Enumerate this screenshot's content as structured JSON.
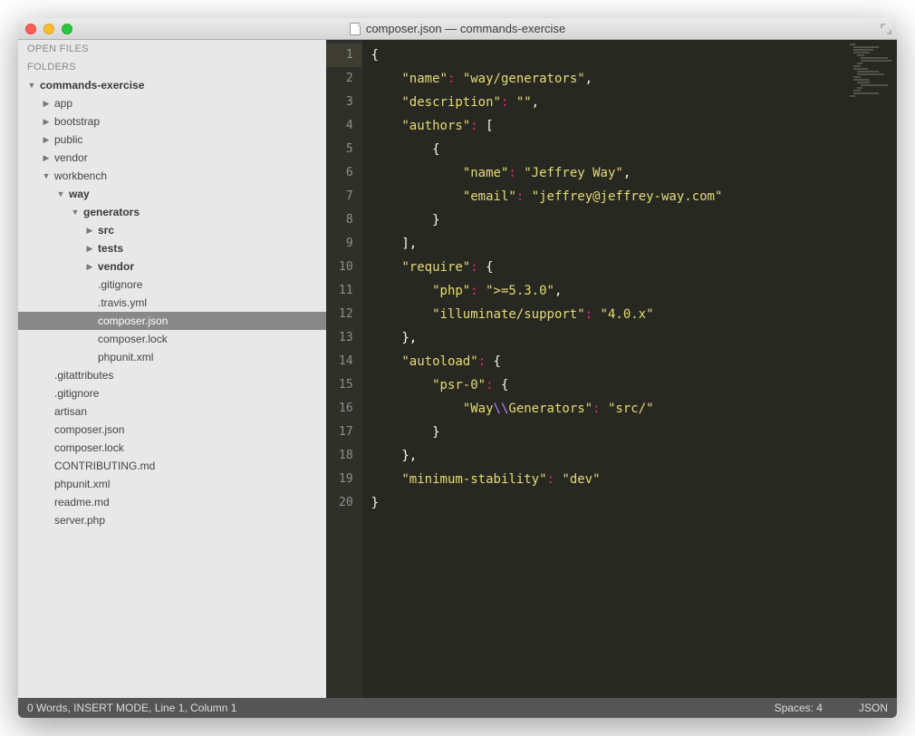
{
  "window": {
    "title": "composer.json — commands-exercise"
  },
  "sidebar": {
    "open_files_label": "OPEN FILES",
    "folders_label": "FOLDERS",
    "tree": [
      {
        "label": "commands-exercise",
        "depth": 0,
        "kind": "folder",
        "open": true,
        "bold": true
      },
      {
        "label": "app",
        "depth": 1,
        "kind": "folder",
        "open": false
      },
      {
        "label": "bootstrap",
        "depth": 1,
        "kind": "folder",
        "open": false
      },
      {
        "label": "public",
        "depth": 1,
        "kind": "folder",
        "open": false
      },
      {
        "label": "vendor",
        "depth": 1,
        "kind": "folder",
        "open": false
      },
      {
        "label": "workbench",
        "depth": 1,
        "kind": "folder",
        "open": true
      },
      {
        "label": "way",
        "depth": 2,
        "kind": "folder",
        "open": true,
        "bold": true
      },
      {
        "label": "generators",
        "depth": 3,
        "kind": "folder",
        "open": true,
        "bold": true
      },
      {
        "label": "src",
        "depth": 4,
        "kind": "folder",
        "open": false,
        "bold": true
      },
      {
        "label": "tests",
        "depth": 4,
        "kind": "folder",
        "open": false,
        "bold": true
      },
      {
        "label": "vendor",
        "depth": 4,
        "kind": "folder",
        "open": false,
        "bold": true
      },
      {
        "label": ".gitignore",
        "depth": 4,
        "kind": "file"
      },
      {
        "label": ".travis.yml",
        "depth": 4,
        "kind": "file"
      },
      {
        "label": "composer.json",
        "depth": 4,
        "kind": "file",
        "selected": true
      },
      {
        "label": "composer.lock",
        "depth": 4,
        "kind": "file"
      },
      {
        "label": "phpunit.xml",
        "depth": 4,
        "kind": "file"
      },
      {
        "label": ".gitattributes",
        "depth": 1,
        "kind": "file"
      },
      {
        "label": ".gitignore",
        "depth": 1,
        "kind": "file"
      },
      {
        "label": "artisan",
        "depth": 1,
        "kind": "file"
      },
      {
        "label": "composer.json",
        "depth": 1,
        "kind": "file"
      },
      {
        "label": "composer.lock",
        "depth": 1,
        "kind": "file"
      },
      {
        "label": "CONTRIBUTING.md",
        "depth": 1,
        "kind": "file"
      },
      {
        "label": "phpunit.xml",
        "depth": 1,
        "kind": "file"
      },
      {
        "label": "readme.md",
        "depth": 1,
        "kind": "file"
      },
      {
        "label": "server.php",
        "depth": 1,
        "kind": "file"
      }
    ]
  },
  "editor": {
    "filename": "composer.json",
    "line_count": 20,
    "lines": [
      [
        {
          "t": "punct",
          "v": "{"
        }
      ],
      [
        {
          "t": "indent",
          "v": 1
        },
        {
          "t": "key",
          "v": "\"name\""
        },
        {
          "t": "colon",
          "v": ": "
        },
        {
          "t": "str",
          "v": "\"way/generators\""
        },
        {
          "t": "punct",
          "v": ","
        }
      ],
      [
        {
          "t": "indent",
          "v": 1
        },
        {
          "t": "key",
          "v": "\"description\""
        },
        {
          "t": "colon",
          "v": ": "
        },
        {
          "t": "str",
          "v": "\"\""
        },
        {
          "t": "punct",
          "v": ","
        }
      ],
      [
        {
          "t": "indent",
          "v": 1
        },
        {
          "t": "key",
          "v": "\"authors\""
        },
        {
          "t": "colon",
          "v": ": "
        },
        {
          "t": "punct",
          "v": "["
        }
      ],
      [
        {
          "t": "indent",
          "v": 2
        },
        {
          "t": "punct",
          "v": "{"
        }
      ],
      [
        {
          "t": "indent",
          "v": 3
        },
        {
          "t": "key",
          "v": "\"name\""
        },
        {
          "t": "colon",
          "v": ": "
        },
        {
          "t": "str",
          "v": "\"Jeffrey Way\""
        },
        {
          "t": "punct",
          "v": ","
        }
      ],
      [
        {
          "t": "indent",
          "v": 3
        },
        {
          "t": "key",
          "v": "\"email\""
        },
        {
          "t": "colon",
          "v": ": "
        },
        {
          "t": "str",
          "v": "\"jeffrey@jeffrey-way.com\""
        }
      ],
      [
        {
          "t": "indent",
          "v": 2
        },
        {
          "t": "punct",
          "v": "}"
        }
      ],
      [
        {
          "t": "indent",
          "v": 1
        },
        {
          "t": "punct",
          "v": "],"
        }
      ],
      [
        {
          "t": "indent",
          "v": 1
        },
        {
          "t": "key",
          "v": "\"require\""
        },
        {
          "t": "colon",
          "v": ": "
        },
        {
          "t": "punct",
          "v": "{"
        }
      ],
      [
        {
          "t": "indent",
          "v": 2
        },
        {
          "t": "key",
          "v": "\"php\""
        },
        {
          "t": "colon",
          "v": ": "
        },
        {
          "t": "str",
          "v": "\">=5.3.0\""
        },
        {
          "t": "punct",
          "v": ","
        }
      ],
      [
        {
          "t": "indent",
          "v": 2
        },
        {
          "t": "key",
          "v": "\"illuminate/support\""
        },
        {
          "t": "colon",
          "v": ": "
        },
        {
          "t": "str",
          "v": "\"4.0.x\""
        }
      ],
      [
        {
          "t": "indent",
          "v": 1
        },
        {
          "t": "punct",
          "v": "},"
        }
      ],
      [
        {
          "t": "indent",
          "v": 1
        },
        {
          "t": "key",
          "v": "\"autoload\""
        },
        {
          "t": "colon",
          "v": ": "
        },
        {
          "t": "punct",
          "v": "{"
        }
      ],
      [
        {
          "t": "indent",
          "v": 2
        },
        {
          "t": "key",
          "v": "\"psr-0\""
        },
        {
          "t": "colon",
          "v": ": "
        },
        {
          "t": "punct",
          "v": "{"
        }
      ],
      [
        {
          "t": "indent",
          "v": 3
        },
        {
          "t": "key",
          "v": "\"Way"
        },
        {
          "t": "esc",
          "v": "\\\\"
        },
        {
          "t": "key",
          "v": "Generators\""
        },
        {
          "t": "colon",
          "v": ": "
        },
        {
          "t": "str",
          "v": "\"src/\""
        }
      ],
      [
        {
          "t": "indent",
          "v": 2
        },
        {
          "t": "punct",
          "v": "}"
        }
      ],
      [
        {
          "t": "indent",
          "v": 1
        },
        {
          "t": "punct",
          "v": "},"
        }
      ],
      [
        {
          "t": "indent",
          "v": 1
        },
        {
          "t": "key",
          "v": "\"minimum-stability\""
        },
        {
          "t": "colon",
          "v": ": "
        },
        {
          "t": "str",
          "v": "\"dev\""
        }
      ],
      [
        {
          "t": "punct",
          "v": "}"
        }
      ]
    ]
  },
  "statusbar": {
    "left": "0 Words, INSERT MODE, Line 1, Column 1",
    "indent": "Spaces: 4",
    "syntax": "JSON"
  }
}
